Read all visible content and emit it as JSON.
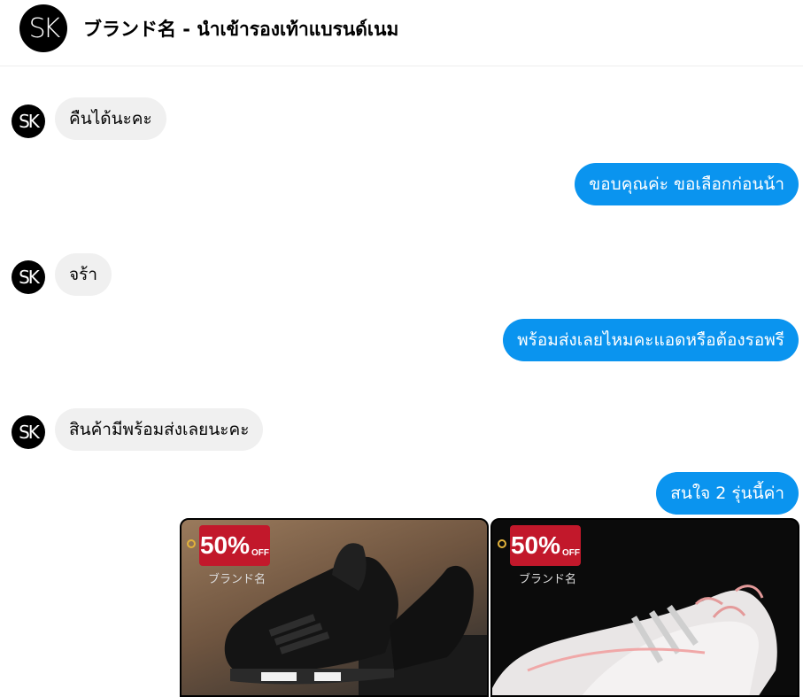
{
  "header": {
    "avatar_text": "SK",
    "title": "ブランド名 - นำเข้ารองเท้าแบรนด์เนม"
  },
  "messages": [
    {
      "from": "page",
      "avatar_text": "SK",
      "text": "คืนได้นะคะ"
    },
    {
      "from": "user",
      "text": "ขอบคุณค่ะ ขอเลือกก่อนน้า"
    },
    {
      "from": "page",
      "avatar_text": "SK",
      "text": "จร้า"
    },
    {
      "from": "user",
      "text": "พร้อมส่งเลยไหมคะแอดหรือต้องรอพรี"
    },
    {
      "from": "page",
      "avatar_text": "SK",
      "text": "สินค้ามีพร้อมส่งเลยนะคะ"
    },
    {
      "from": "user",
      "text": "สนใจ 2 รุ่นนี้ค่า"
    }
  ],
  "attachments": [
    {
      "badge": "50%",
      "badge_suffix": "OFF",
      "watermark": "ブランド名"
    },
    {
      "badge": "50%",
      "badge_suffix": "OFF",
      "watermark": "ブランド名"
    }
  ],
  "colors": {
    "outgoing_bubble": "#0a94ef",
    "incoming_bubble": "#f0f0f0",
    "badge": "#c2182b"
  }
}
